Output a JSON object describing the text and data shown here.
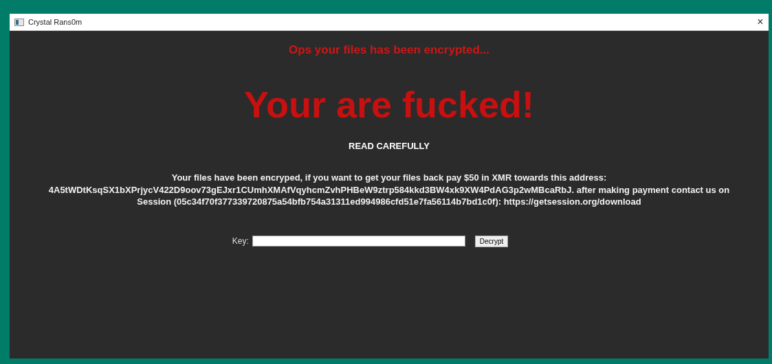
{
  "window": {
    "title": "Crystal Rans0m",
    "close": "×"
  },
  "subtitle": "Ops your files has been encrypted...",
  "headline": "Your are fucked!",
  "notice": "READ CAREFULLY",
  "message_lines": [
    "Your files have been encryped, if you want to get your files back pay $50 in XMR towards this address:",
    "4A5tWDtKsqSX1bXPrjycV422D9oov73gEJxr1CUmhXMAfVqyhcmZvhPHBeW9ztrp584kkd3BW4xk9XW4PdAG3p2wMBcaRbJ. after making payment contact us on",
    "Session (05c34f70f377339720875a54bfb754a31311ed994986cfd51e7fa56114b7bd1c0f): https://getsession.org/download"
  ],
  "key_field": {
    "label": "Key:"
  },
  "decrypt_button": "Decrypt"
}
